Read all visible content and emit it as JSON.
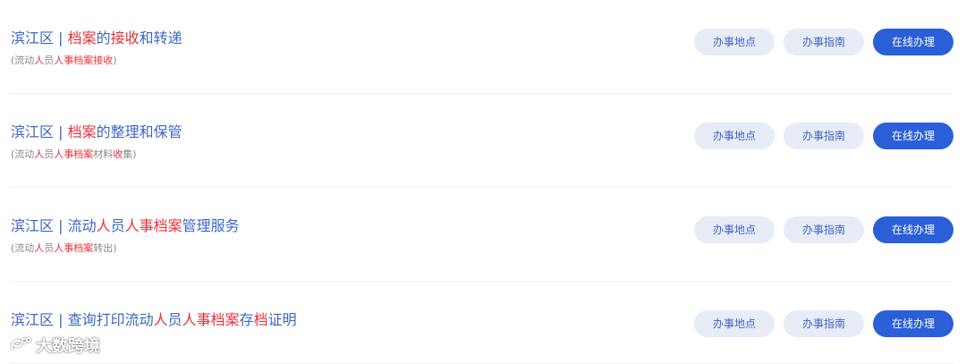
{
  "items": [
    {
      "title": [
        {
          "text": "滨江区 | ",
          "hl": false
        },
        {
          "text": "档案",
          "hl": true
        },
        {
          "text": "的",
          "hl": false
        },
        {
          "text": "接收",
          "hl": true
        },
        {
          "text": "和转递",
          "hl": false
        }
      ],
      "subtitle": [
        {
          "text": "(流动",
          "hl": false
        },
        {
          "text": "人",
          "hl": true
        },
        {
          "text": "员",
          "hl": false
        },
        {
          "text": "人事档案接收",
          "hl": true
        },
        {
          "text": ")",
          "hl": false
        }
      ],
      "buttons": {
        "location": "办事地点",
        "guide": "办事指南",
        "online": "在线办理"
      }
    },
    {
      "title": [
        {
          "text": "滨江区 | ",
          "hl": false
        },
        {
          "text": "档案",
          "hl": true
        },
        {
          "text": "的整理和保管",
          "hl": false
        }
      ],
      "subtitle": [
        {
          "text": "(流动",
          "hl": false
        },
        {
          "text": "人",
          "hl": true
        },
        {
          "text": "员",
          "hl": false
        },
        {
          "text": "人事档案",
          "hl": true
        },
        {
          "text": "材料",
          "hl": false
        },
        {
          "text": "收",
          "hl": true
        },
        {
          "text": "集)",
          "hl": false
        }
      ],
      "buttons": {
        "location": "办事地点",
        "guide": "办事指南",
        "online": "在线办理"
      }
    },
    {
      "title": [
        {
          "text": "滨江区 | 流动",
          "hl": false
        },
        {
          "text": "人",
          "hl": true
        },
        {
          "text": "员",
          "hl": false
        },
        {
          "text": "人事档案",
          "hl": true
        },
        {
          "text": "管理服务",
          "hl": false
        }
      ],
      "subtitle": [
        {
          "text": "(流动",
          "hl": false
        },
        {
          "text": "人",
          "hl": true
        },
        {
          "text": "员",
          "hl": false
        },
        {
          "text": "人事档案",
          "hl": true
        },
        {
          "text": "转出)",
          "hl": false
        }
      ],
      "buttons": {
        "location": "办事地点",
        "guide": "办事指南",
        "online": "在线办理"
      }
    },
    {
      "title": [
        {
          "text": "滨江区 | 查询打印流动",
          "hl": false
        },
        {
          "text": "人",
          "hl": true
        },
        {
          "text": "员",
          "hl": false
        },
        {
          "text": "人事档案",
          "hl": true
        },
        {
          "text": "存",
          "hl": false
        },
        {
          "text": "档",
          "hl": true
        },
        {
          "text": "证明",
          "hl": false
        }
      ],
      "subtitle": [],
      "buttons": {
        "location": "办事地点",
        "guide": "办事指南",
        "online": "在线办理"
      }
    }
  ],
  "watermark": {
    "text": "大数跨境",
    "icon": "weibo-like-logo-icon"
  },
  "colors": {
    "link": "#3d66c7",
    "highlight": "#e8313b",
    "primary": "#2a5fd8",
    "light_btn_bg": "#e8ecf7"
  }
}
